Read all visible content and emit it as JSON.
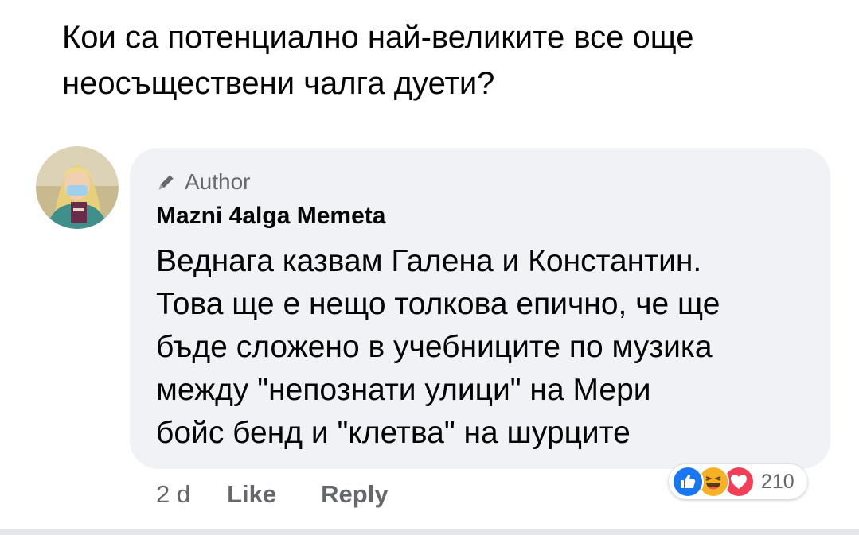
{
  "post": {
    "text": "Кои са потенциално най-великите все още неосъществени чалга дуети?"
  },
  "comment": {
    "badge": "Author",
    "author_name": "Mazni 4algа Memeta",
    "lines": [
      "Веднага казвам Галена и Константин.",
      "Това ще е нещо толкова епично, че ще",
      "бъде сложено в учебниците по музика",
      "между \"непознати улици\" на Мери",
      "бойс бенд и \"клетва\" на шурците"
    ],
    "time": "2 d",
    "like_label": "Like",
    "reply_label": "Reply",
    "reactions": {
      "icons": [
        "like-icon",
        "haha-icon",
        "love-icon"
      ],
      "count": "210"
    }
  },
  "colors": {
    "bubble": "#f0f2f5",
    "secondary_text": "#65676b",
    "like_blue": "#1877f2",
    "love_red": "#f33e58",
    "haha_yellow": "#f7b125"
  }
}
